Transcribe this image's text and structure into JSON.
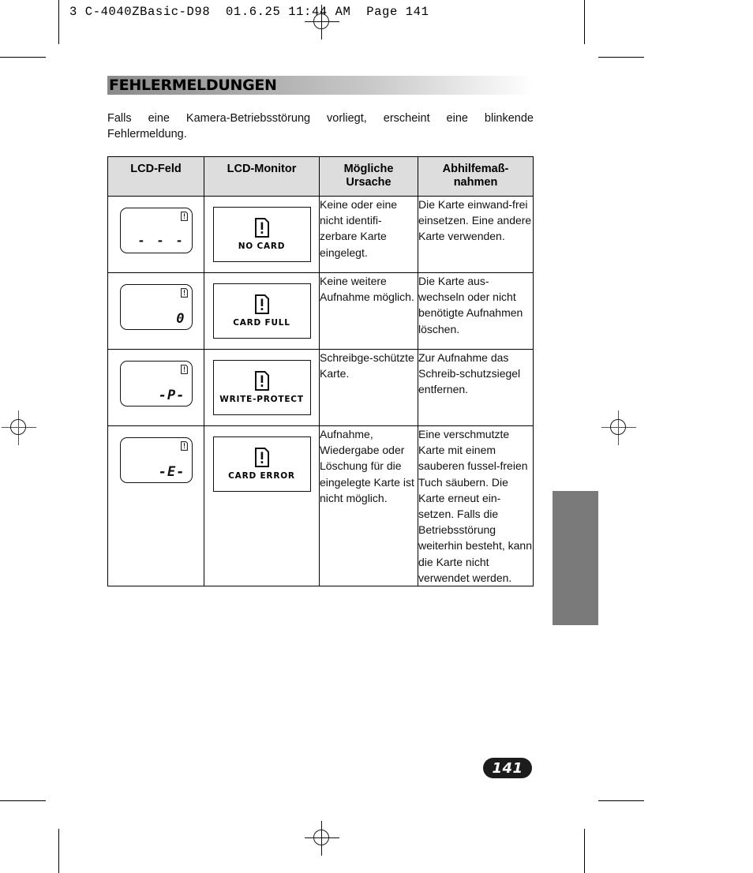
{
  "printer_header": "3 C-4040ZBasic-D98  01.6.25 11:44 AM  Page 141",
  "section": {
    "title": "FEHLERMELDUNGEN",
    "intro_line1": "Falls eine Kamera-Betriebsstörung vorliegt, erscheint eine blinkende",
    "intro_line2": "Fehlermeldung."
  },
  "table": {
    "headers": {
      "col1": "LCD-Feld",
      "col2": "LCD-Monitor",
      "col3_line1": "Mögliche",
      "col3_line2": "Ursache",
      "col4_line1": "Abhilfemaß-",
      "col4_line2": "nahmen"
    },
    "rows": [
      {
        "lcd_field_value": "- - -",
        "lcd_field_badge": "card-warning-icon",
        "monitor_message": "NO CARD",
        "cause": "Keine oder eine nicht identifi-zerbare Karte eingelegt.",
        "remedy": "Die Karte einwand-frei einsetzen. Eine andere Karte verwenden."
      },
      {
        "lcd_field_value": "0",
        "lcd_field_badge": "card-warning-icon",
        "monitor_message": "CARD FULL",
        "cause": "Keine weitere Aufnahme möglich.",
        "remedy": "Die Karte aus-wechseln oder nicht benötigte Aufnahmen löschen."
      },
      {
        "lcd_field_value": "-P-",
        "lcd_field_badge": "card-warning-icon",
        "monitor_message": "WRITE-PROTECT",
        "cause": "Schreibge-schützte Karte.",
        "remedy": "Zur Aufnahme das Schreib-schutzsiegel entfernen."
      },
      {
        "lcd_field_value": "-E-",
        "lcd_field_badge": "card-warning-icon",
        "monitor_message": "CARD ERROR",
        "cause": "Aufnahme, Wiedergabe oder Löschung für die eingelegte Karte ist nicht möglich.",
        "remedy": "Eine verschmutzte Karte mit einem sauberen fussel-freien Tuch säubern. Die Karte erneut ein-setzen. Falls die Betriebsstörung weiterhin besteht, kann die Karte nicht verwendet werden."
      }
    ]
  },
  "page_number": "141",
  "colors": {
    "header_fill": "#dddddd",
    "thumb_tab": "#7a7a7a",
    "page_pill": "#1c1c1c",
    "rule": "#000000"
  }
}
